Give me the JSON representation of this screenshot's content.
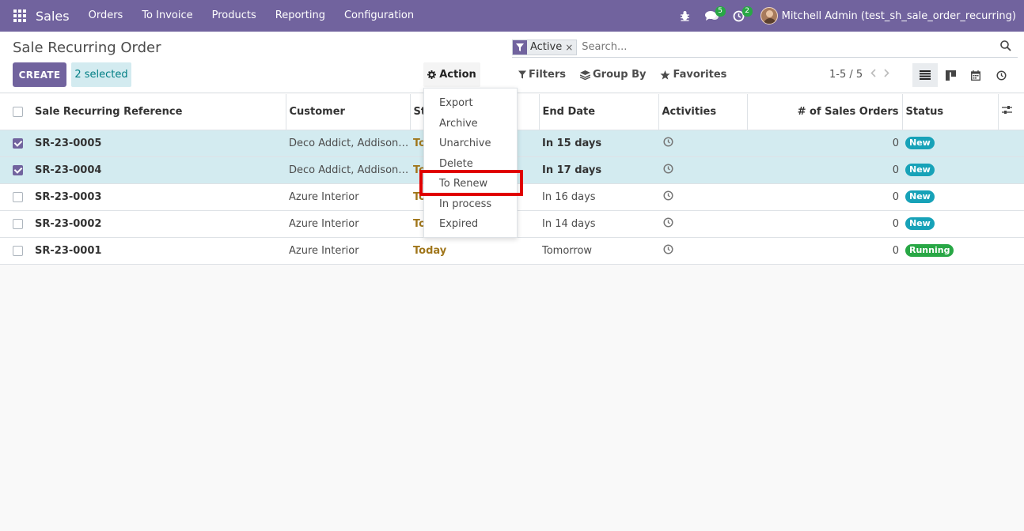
{
  "navbar": {
    "brand": "Sales",
    "menu": [
      "Orders",
      "To Invoice",
      "Products",
      "Reporting",
      "Configuration"
    ],
    "messages_count": "5",
    "activities_count": "2",
    "user_name": "Mitchell Admin (test_sh_sale_order_recurring)"
  },
  "control": {
    "title": "Sale Recurring Order",
    "create_label": "CREATE",
    "selected_label": "2 selected",
    "action_label": "Action",
    "facet_label": "Active",
    "search_placeholder": "Search...",
    "filters_label": "Filters",
    "groupby_label": "Group By",
    "favorites_label": "Favorites",
    "pager": "1-5 / 5"
  },
  "action_menu": {
    "items": [
      "Export",
      "Archive",
      "Unarchive",
      "Delete",
      "To Renew",
      "In process",
      "Expired"
    ],
    "highlighted": "To Renew"
  },
  "table": {
    "columns": [
      "Sale Recurring Reference",
      "Customer",
      "St",
      "End Date",
      "Activities",
      "# of Sales Orders",
      "Status"
    ],
    "rows": [
      {
        "ref": "SR-23-0005",
        "customer": "Deco Addict, Addison ...",
        "start": "To",
        "end": "In 15 days",
        "orders": "0",
        "status": "New",
        "selected": true
      },
      {
        "ref": "SR-23-0004",
        "customer": "Deco Addict, Addison ...",
        "start": "To",
        "end": "In 17 days",
        "orders": "0",
        "status": "New",
        "selected": true
      },
      {
        "ref": "SR-23-0003",
        "customer": "Azure Interior",
        "start": "To",
        "end": "In 16 days",
        "orders": "0",
        "status": "New",
        "selected": false
      },
      {
        "ref": "SR-23-0002",
        "customer": "Azure Interior",
        "start": "To",
        "end": "In 14 days",
        "orders": "0",
        "status": "New",
        "selected": false
      },
      {
        "ref": "SR-23-0001",
        "customer": "Azure Interior",
        "start": "Today",
        "end": "Tomorrow",
        "orders": "0",
        "status": "Running",
        "selected": false
      }
    ]
  },
  "colors": {
    "primary": "#71639e",
    "selected_row": "#d3ebf0",
    "status_new": "#17a2b8",
    "status_running": "#28a745",
    "highlight": "#e00000"
  }
}
